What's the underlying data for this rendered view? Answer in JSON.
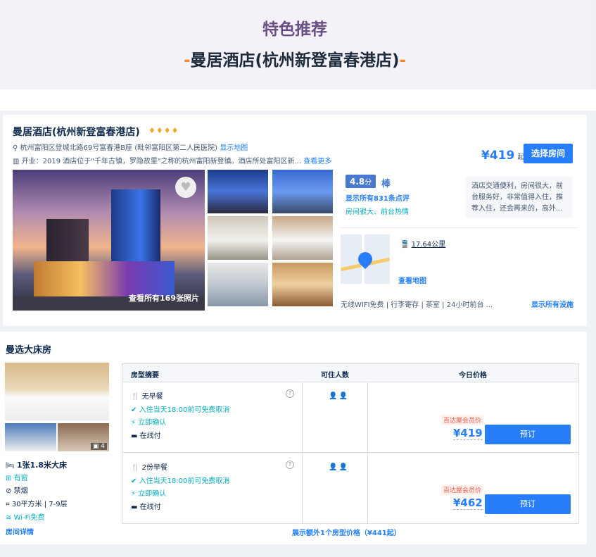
{
  "banner": {
    "title": "特色推荐",
    "dash_left": "-",
    "hotel_name": "曼居酒店(杭州新登富春港店)",
    "dash_right": "-"
  },
  "hotel": {
    "name": "曼居酒店(杭州新登富春港店)",
    "stars": "♦♦♦♦",
    "address": "杭州富阳区登城北路69号富春港B座 (毗邻富阳区第二人民医院)",
    "show_map": "显示地图",
    "intro": "开业：2019  酒店位于\"千年古镇，罗隐故里\"之称的杭州富阳新登镇。酒店所处富阳区新...",
    "see_more": "查看更多",
    "price": "¥419",
    "price_suffix": "起",
    "select_room": "选择房间",
    "photos_caption": "查看所有169张照片",
    "score": "4.8",
    "score_unit": "分",
    "score_word": "棒",
    "reviews_link": "显示所有831条点评",
    "tags": "房间很大、前台热情",
    "review_snippet": "酒店交通便利，房间很大，前台服务好，非常值得入住，推荐入住，还会再来的，高外...",
    "metro_distance": "17.64公里",
    "view_map": "查看地图",
    "facilities": "无线WIFI免费 | 行李寄存 | 茶室 | 24小时前台  ...",
    "show_facilities": "显示所有设施",
    "accent_color": "#287dfa"
  },
  "room": {
    "title": "曼选大床房",
    "image_count": "4",
    "bed": "1张1.8米大床",
    "window": "有窗",
    "smoking": "禁烟",
    "area_floor": "30平方米 | 7-9层",
    "wifi": "Wi-Fi免费",
    "details_link": "房间详情",
    "table_headers": [
      "房型摘要",
      "可住人数",
      "今日价格"
    ],
    "rates": [
      {
        "meal": "无早餐",
        "cancel": "入住当天18:00前可免费取消",
        "confirm": "立即确认",
        "payment": "在线付",
        "guests": "👤👤",
        "member_label": "百达屋会员价",
        "price": "¥419",
        "book": "预订"
      },
      {
        "meal": "2份早餐",
        "cancel": "入住当天18:00前可免费取消",
        "confirm": "立即确认",
        "payment": "在线付",
        "guests": "👤👤",
        "member_label": "百达屋会员价",
        "price": "¥462",
        "book": "预订"
      }
    ],
    "more_rates_link": "展示额外1个房型价格（¥441起）"
  }
}
